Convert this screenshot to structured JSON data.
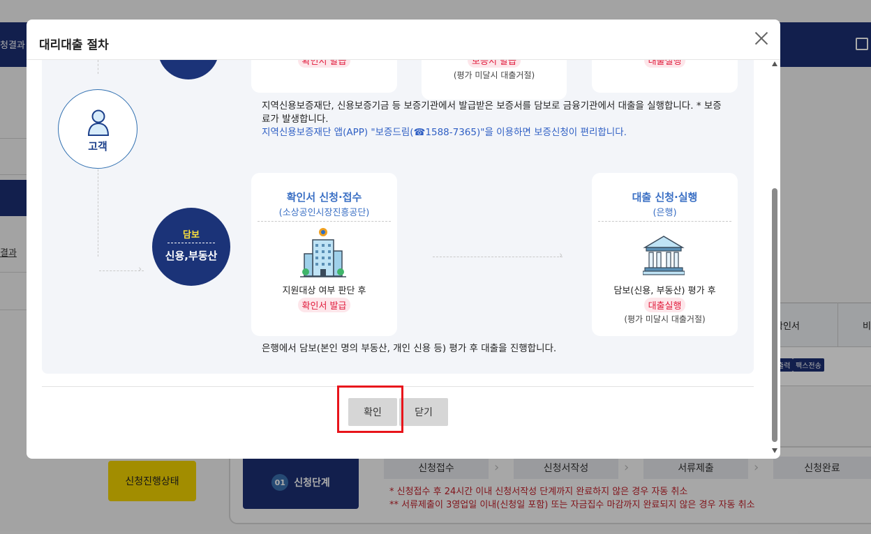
{
  "background": {
    "menu_fragment": "청결과",
    "side_link": "결과",
    "table_headers": [
      "확인서",
      "비"
    ],
    "table_badges": [
      "출력",
      "팩스전송"
    ],
    "status_button": "신청진행상태",
    "step_number": "01",
    "step_label": "신청단계",
    "stages": [
      "신청접수",
      "신청서작성",
      "서류제출",
      "신청완료"
    ],
    "notices": [
      "* 신청접수 후 24시간 이내 신청서작성 단계까지 완료하지 않은 경우 자동 취소",
      "** 서류제출이 3영업일 이내(신청일 포함) 또는 자금집수 마감까지 완료되지 않은 경우 자동 취소"
    ]
  },
  "modal": {
    "title": "대리대출 절차",
    "top_row": {
      "card1_tag": "확인서 발급",
      "card2_tag": "보증서 발급",
      "card2_note": "(평가 미달시 대출거절)",
      "card3_tag": "대출실행"
    },
    "guarantee_text_line1": "지역신용보증재단, 신용보증기금 등 보증기관에서 발급받은 보증서를 담보로 금융기관에서 대출을 실행합니다. * 보증",
    "guarantee_text_line2": "료가 발생합니다.",
    "guarantee_app_text": "지역신용보증재단 앱(APP) \"보증드림(☎1588-7365)\"을 이용하면 보증신청이 편리합니다.",
    "customer_label": "고객",
    "collateral_top": "담보",
    "collateral_bottom": "신용,부동산",
    "card_confirm": {
      "title": "확인서 신청·접수",
      "subtitle": "(소상공인시장진흥공단)",
      "desc": "지원대상 여부 판단 후",
      "tag": "확인서 발급"
    },
    "card_loan": {
      "title": "대출 신청·실행",
      "subtitle": "(은행)",
      "desc": "담보(신용, 부동산) 평가 후",
      "tag": "대출실행",
      "note": "(평가 미달시 대출거절)"
    },
    "bank_text": "은행에서 담보(본인 명의 부동산, 개인 신용 등) 평가 후 대출을 진행합니다.",
    "confirm_button": "확인",
    "close_button": "닫기"
  }
}
